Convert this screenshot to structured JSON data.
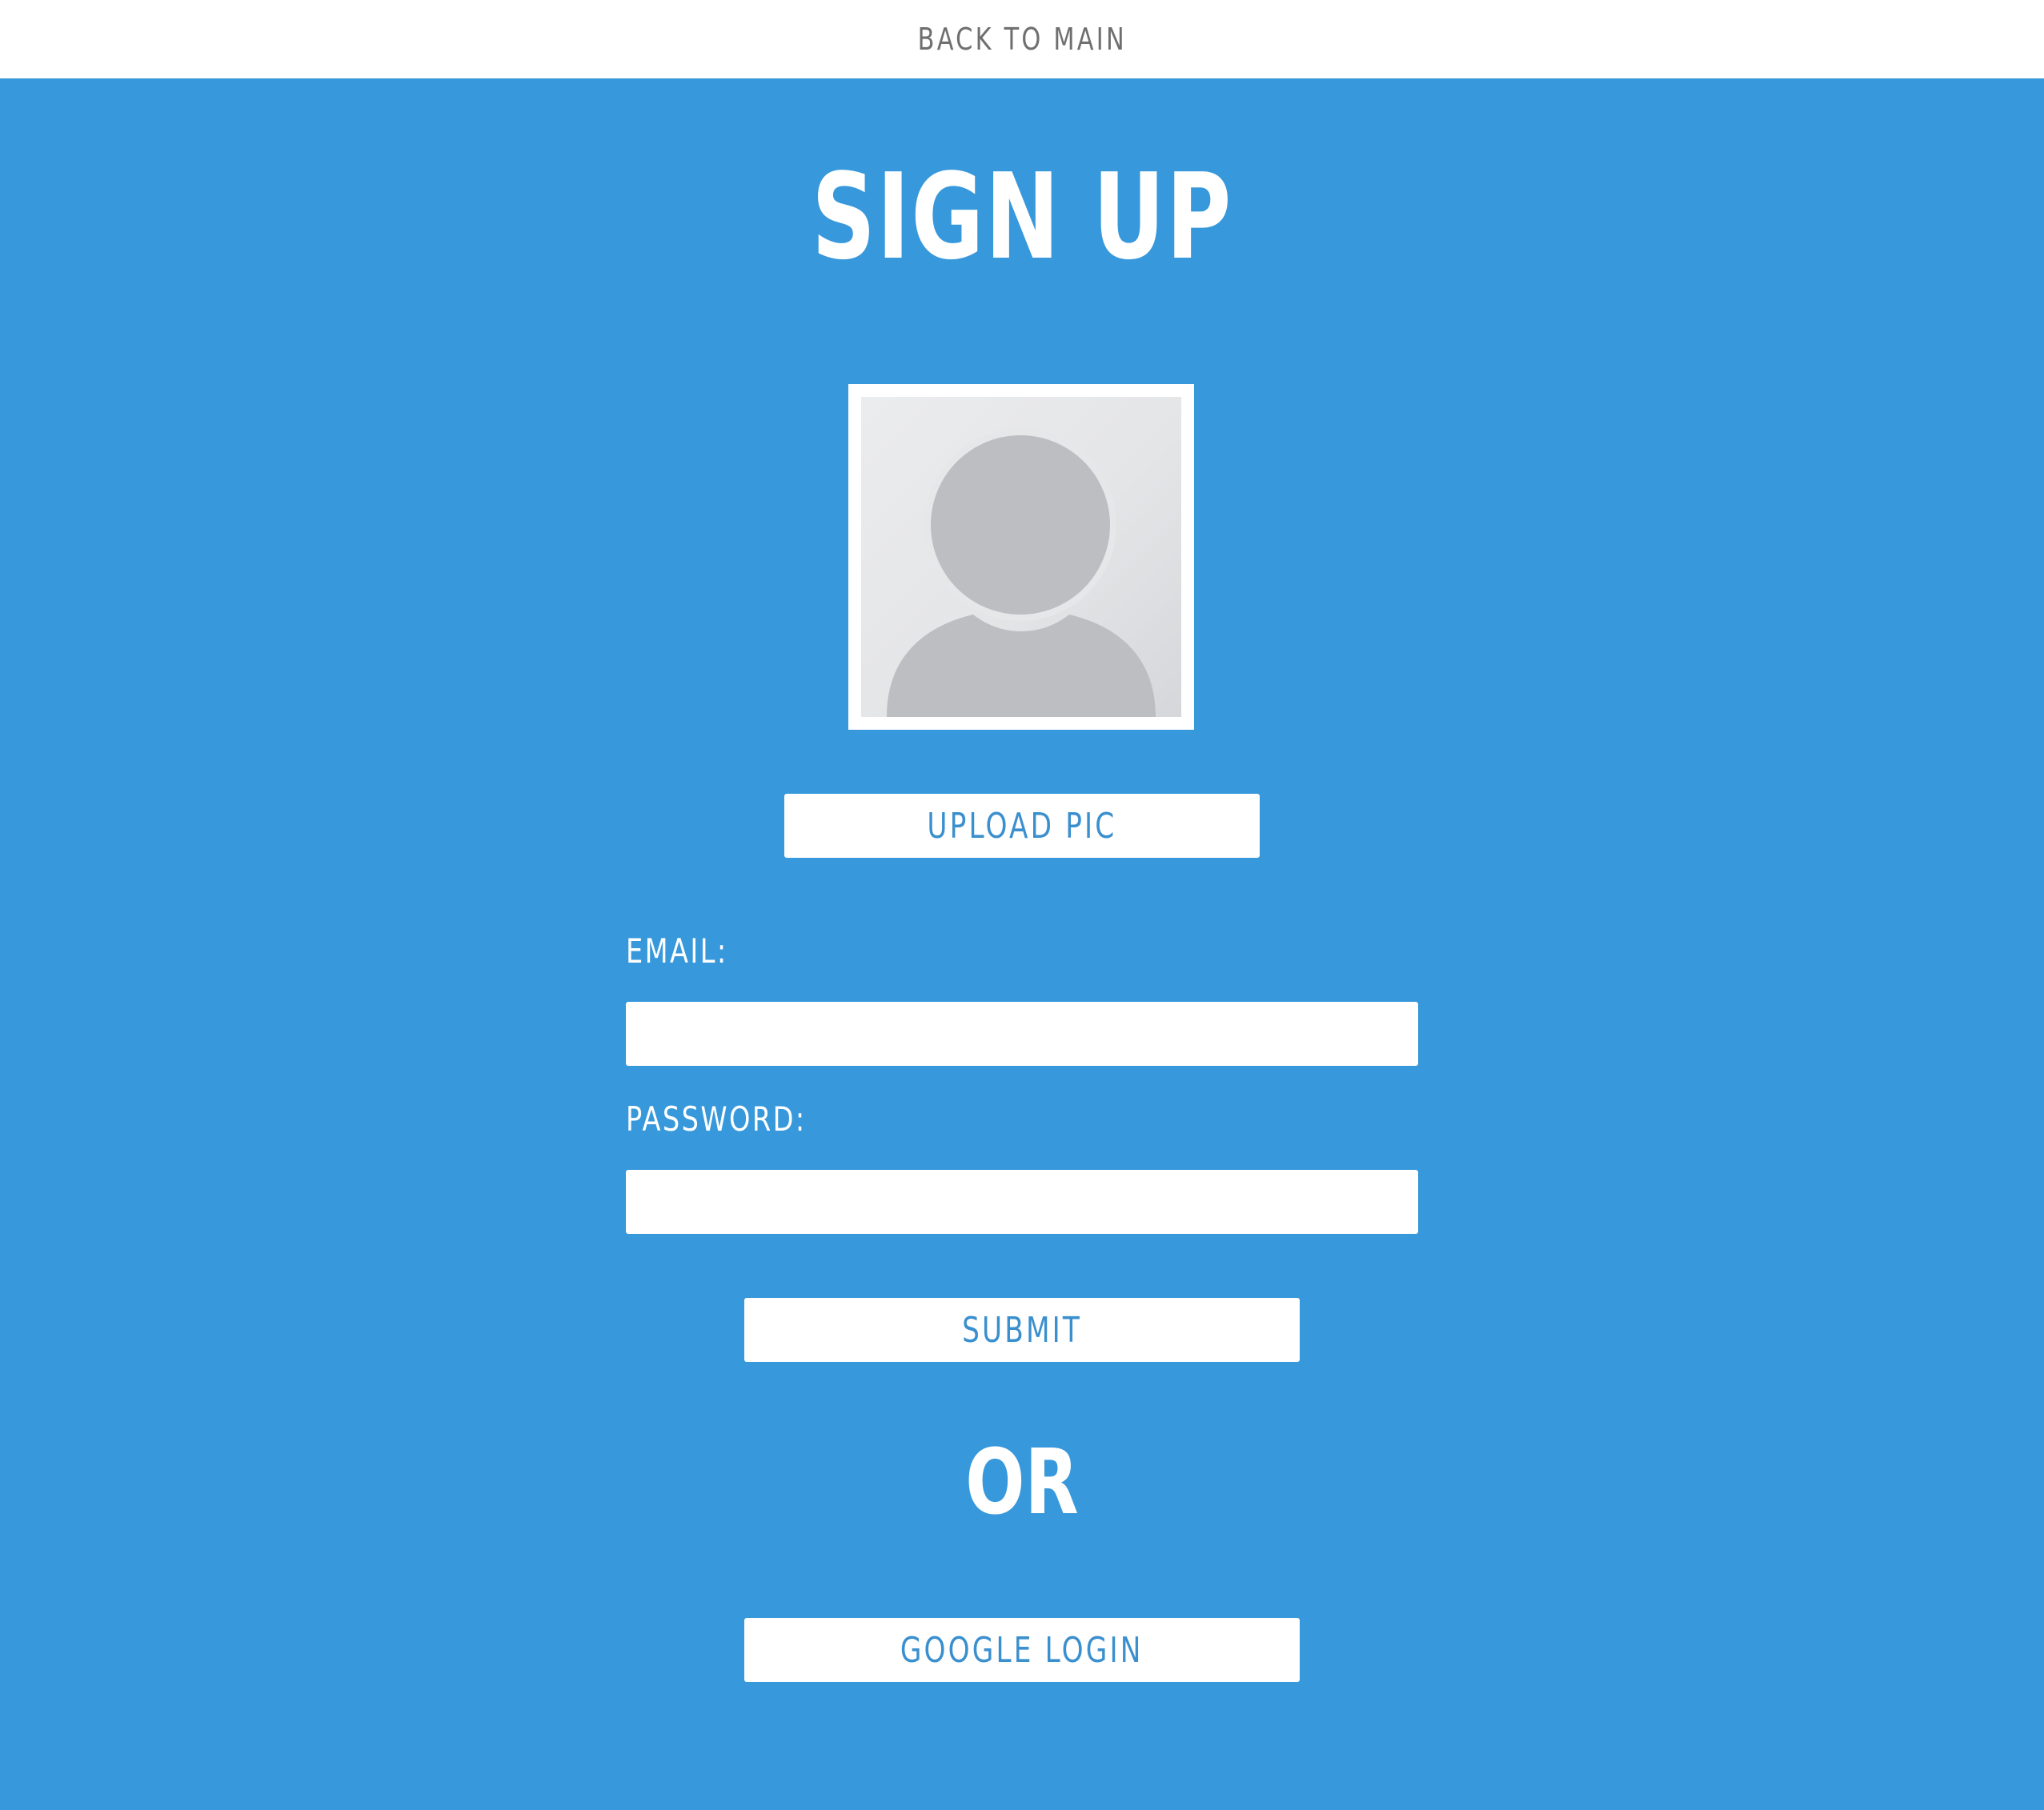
{
  "nav": {
    "back_label": "BACK TO MAIN"
  },
  "page": {
    "title": "SIGN UP",
    "separator": "OR"
  },
  "avatar": {
    "icon": "default-user-avatar-icon"
  },
  "form": {
    "upload_label": "UPLOAD PIC",
    "email_label": "EMAIL:",
    "email_value": "",
    "password_label": "PASSWORD:",
    "password_value": "",
    "submit_label": "SUBMIT",
    "google_label": "GOOGLE LOGIN"
  },
  "colors": {
    "background": "#3798db",
    "topbar": "#ffffff",
    "button_text": "#3a8fce",
    "nav_text": "#6f6f6f"
  }
}
